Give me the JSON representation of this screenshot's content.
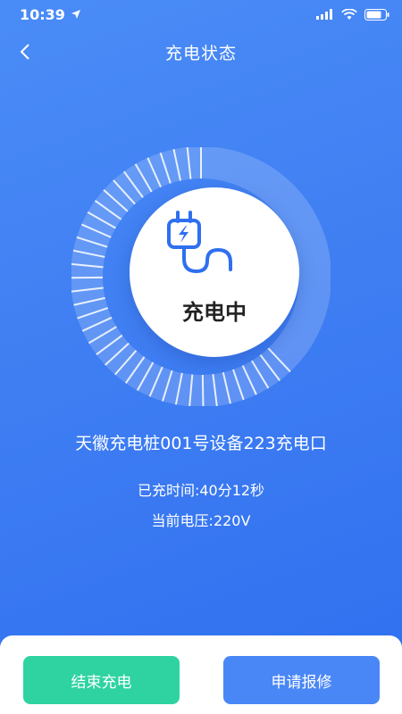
{
  "status_bar": {
    "time": "10:39",
    "icons": [
      "location-arrow-icon",
      "signal-icon",
      "wifi-icon",
      "battery-icon"
    ]
  },
  "nav": {
    "title": "充电状态",
    "back_icon": "chevron-left-icon"
  },
  "charging": {
    "status_label": "充电中",
    "progress": 0.62,
    "icon": "plug-lightning-icon",
    "device_name": "天徽充电桩001号设备223充电口",
    "charged_time": "已充时间:40分12秒",
    "voltage": "当前电压:220V"
  },
  "actions": {
    "stop_label": "结束充电",
    "repair_label": "申请报修"
  },
  "colors": {
    "background": "#3f7ef2",
    "stop_button": "#2ed3a1",
    "repair_button": "#4a87f6",
    "plug_icon": "#2f6ff0"
  }
}
